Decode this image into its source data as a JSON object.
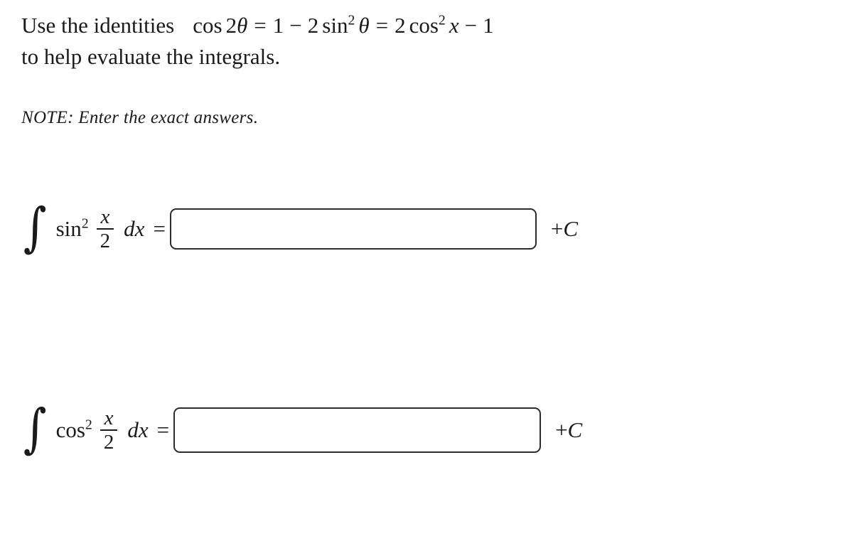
{
  "prompt": {
    "lead_text": "Use the identities",
    "identity": {
      "lhs_fn": "cos",
      "lhs_arg_coef": "2",
      "lhs_arg_var": "θ",
      "rel_1": "=",
      "mid_one": "1",
      "minus": "−",
      "mid_coef": "2",
      "mid_fn": "sin",
      "mid_exp": "2",
      "mid_var": "θ",
      "rel_2": "=",
      "rhs_coef": "2",
      "rhs_fn": "cos",
      "rhs_exp": "2",
      "rhs_var": "x",
      "rhs_minus": "−",
      "rhs_one": "1"
    },
    "second_line": "to help evaluate the integrals.",
    "note": "NOTE: Enter the exact answers."
  },
  "integrals": [
    {
      "integral_symbol": "∫",
      "function": "sin",
      "exponent": "2",
      "numerator": "x",
      "denominator": "2",
      "differential": "dx",
      "equals": "=",
      "answer_value": "",
      "answer_placeholder": "",
      "constant": "+C",
      "constant_sign": "+",
      "constant_letter": "C"
    },
    {
      "integral_symbol": "∫",
      "function": "cos",
      "exponent": "2",
      "numerator": "x",
      "denominator": "2",
      "differential": "dx",
      "equals": "=",
      "answer_value": "",
      "answer_placeholder": "",
      "constant": "+C",
      "constant_sign": "+",
      "constant_letter": "C"
    }
  ],
  "colors": {
    "background": "#ffffff",
    "text": "#1a1a1a",
    "input_border": "#2b2b2b"
  }
}
